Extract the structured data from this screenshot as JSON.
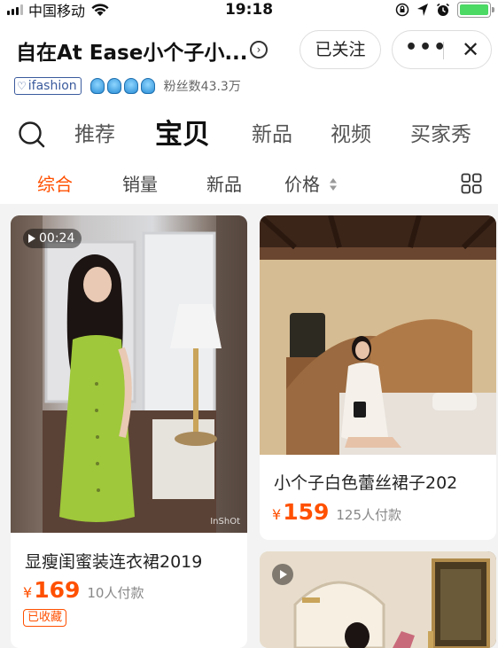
{
  "status_bar": {
    "carrier": "中国移动",
    "time": "19:18"
  },
  "shop": {
    "name": "自在At Ease小个子小...",
    "follow_label": "已关注",
    "more_label": "•••",
    "close_label": "✕",
    "badge_label": "ifashion",
    "fans_label": "粉丝数43.3万"
  },
  "main_tabs": [
    {
      "label": "推荐",
      "active": false
    },
    {
      "label": "宝贝",
      "active": true
    },
    {
      "label": "新品",
      "active": false
    },
    {
      "label": "视频",
      "active": false
    },
    {
      "label": "买家秀",
      "active": false
    }
  ],
  "sub_tabs": [
    {
      "label": "综合",
      "active": true
    },
    {
      "label": "销量",
      "active": false
    },
    {
      "label": "新品",
      "active": false
    },
    {
      "label": "价格",
      "active": false
    }
  ],
  "products": [
    {
      "video_duration": "00:24",
      "watermark": "InShOt",
      "title": "显瘦闺蜜装连衣裙2019",
      "currency": "¥",
      "price": "169",
      "sold": "10人付款",
      "tag": "已收藏"
    },
    {
      "title": "小个子白色蕾丝裙子202",
      "currency": "¥",
      "price": "159",
      "sold": "125人付款"
    },
    {
      "has_video": true
    }
  ],
  "colors": {
    "accent": "#ff5000",
    "battery": "#4cd964"
  }
}
